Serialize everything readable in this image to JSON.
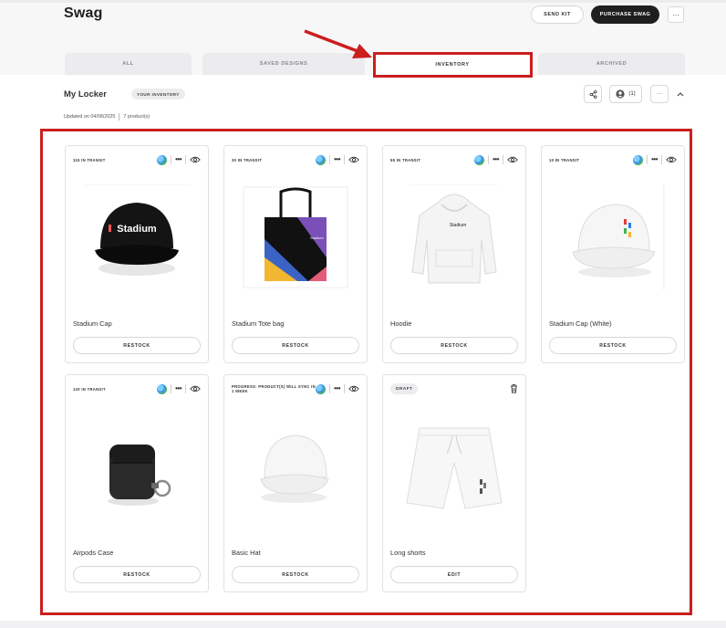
{
  "header": {
    "title": "Swag",
    "send_kit_label": "SEND KIT",
    "purchase_label": "PURCHASE SWAG",
    "more_label": "···"
  },
  "tabs": [
    {
      "label": "ALL",
      "active": false
    },
    {
      "label": "SAVED DESIGNS",
      "active": false
    },
    {
      "label": "INVENTORY",
      "active": true
    },
    {
      "label": "ARCHIVED",
      "active": false
    }
  ],
  "locker": {
    "title": "My Locker",
    "badge": "YOUR INVENTORY",
    "updated": "Updated on 04/08/2025",
    "product_count": "7 product(s)",
    "members_count": "(1)",
    "more_label": "···"
  },
  "products": [
    {
      "status": "115 IN TRANSIT",
      "name": "Stadium Cap",
      "action": "RESTOCK",
      "image": "black-cap-icon"
    },
    {
      "status": "30 IN TRANSIT",
      "name": "Stadium Tote bag",
      "action": "RESTOCK",
      "image": "tote-bag-icon"
    },
    {
      "status": "55 IN TRANSIT",
      "name": "Hoodie",
      "action": "RESTOCK",
      "image": "hoodie-icon"
    },
    {
      "status": "10 IN TRANSIT",
      "name": "Stadium Cap (White)",
      "action": "RESTOCK",
      "image": "white-cap-icon"
    },
    {
      "status": "120 IN TRANSIT",
      "name": "Airpods Case",
      "action": "RESTOCK",
      "image": "airpods-case-icon"
    },
    {
      "status": "PROGRESS: PRODUCT(S) WILL SYNC IN 1 WEEK",
      "name": "Basic Hat",
      "action": "RESTOCK",
      "image": "basic-hat-icon"
    },
    {
      "status": "DRAFT",
      "name": "Long shorts",
      "action": "EDIT",
      "image": "shorts-icon"
    }
  ],
  "colors": {
    "annotation_red": "#cc1e1e",
    "dark_button": "#1f1f1f",
    "tab_bg": "#ececee"
  }
}
